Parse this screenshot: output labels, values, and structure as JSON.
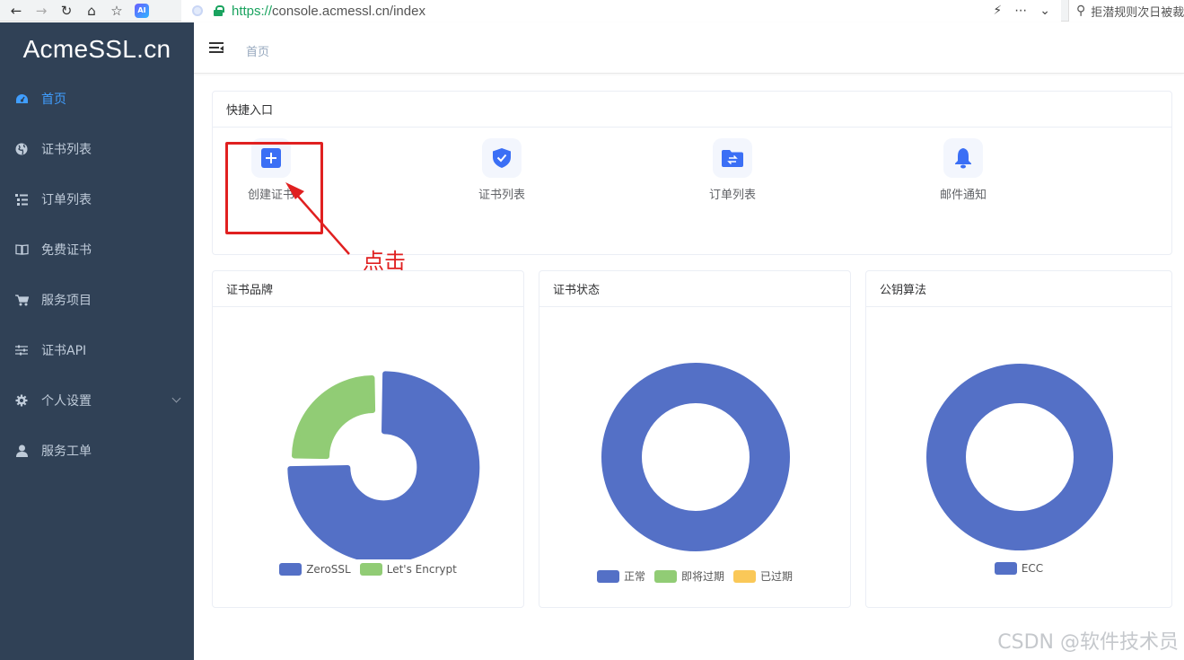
{
  "browser": {
    "url_scheme": "https://",
    "url_rest": "console.acmessl.cn/index",
    "search_text": "拒潜规则次日被裁",
    "ai_badge": "AI"
  },
  "sidebar": {
    "logo": "AcmeSSL.cn",
    "items": [
      {
        "label": "首页",
        "icon": "dashboard-icon",
        "active": true
      },
      {
        "label": "证书列表",
        "icon": "globe-icon"
      },
      {
        "label": "订单列表",
        "icon": "list-icon"
      },
      {
        "label": "免费证书",
        "icon": "book-icon"
      },
      {
        "label": "服务项目",
        "icon": "cart-icon"
      },
      {
        "label": "证书API",
        "icon": "sliders-icon"
      },
      {
        "label": "个人设置",
        "icon": "gear-icon",
        "has_submenu": true
      },
      {
        "label": "服务工单",
        "icon": "user-icon"
      }
    ]
  },
  "header": {
    "breadcrumb": "首页"
  },
  "quick_entry": {
    "title": "快捷入口",
    "items": [
      {
        "label": "创建证书",
        "icon": "plus-icon"
      },
      {
        "label": "证书列表",
        "icon": "shield-check-icon"
      },
      {
        "label": "订单列表",
        "icon": "folder-transfer-icon"
      },
      {
        "label": "邮件通知",
        "icon": "bell-icon"
      }
    ]
  },
  "annotation": {
    "text": "点击"
  },
  "chart_data": [
    {
      "type": "pie",
      "title": "证书品牌",
      "categories": [
        "ZeroSSL",
        "Let's Encrypt"
      ],
      "values": [
        75,
        25
      ],
      "colors": [
        "#5470c6",
        "#91cc75"
      ]
    },
    {
      "type": "pie",
      "title": "证书状态",
      "categories": [
        "正常",
        "即将过期",
        "已过期"
      ],
      "values": [
        100,
        0,
        0
      ],
      "colors": [
        "#5470c6",
        "#91cc75",
        "#fac858"
      ]
    },
    {
      "type": "pie",
      "title": "公钥算法",
      "categories": [
        "ECC"
      ],
      "values": [
        100
      ],
      "colors": [
        "#5470c6"
      ]
    }
  ],
  "watermark": "CSDN @软件技术员"
}
